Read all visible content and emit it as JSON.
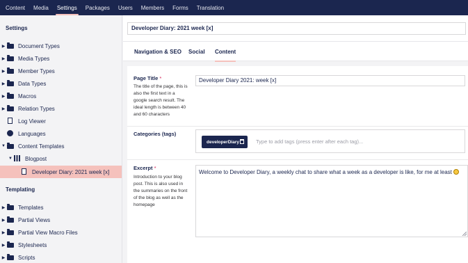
{
  "topnav": {
    "items": [
      {
        "label": "Content"
      },
      {
        "label": "Media"
      },
      {
        "label": "Settings",
        "active": true
      },
      {
        "label": "Packages"
      },
      {
        "label": "Users"
      },
      {
        "label": "Members"
      },
      {
        "label": "Forms"
      },
      {
        "label": "Translation"
      }
    ],
    "accent_color": "#f5c1bc",
    "background_color": "#1b264f"
  },
  "sidebar": {
    "settings_heading": "Settings",
    "items": [
      {
        "label": "Document Types",
        "icon": "folder-icon",
        "has_caret": true
      },
      {
        "label": "Media Types",
        "icon": "folder-icon",
        "has_caret": true
      },
      {
        "label": "Member Types",
        "icon": "folder-icon",
        "has_caret": true
      },
      {
        "label": "Data Types",
        "icon": "folder-icon",
        "has_caret": true
      },
      {
        "label": "Macros",
        "icon": "folder-icon",
        "has_caret": true
      },
      {
        "label": "Relation Types",
        "icon": "folder-icon",
        "has_caret": true
      },
      {
        "label": "Log Viewer",
        "icon": "document-icon",
        "has_caret": false
      },
      {
        "label": "Languages",
        "icon": "globe-icon",
        "has_caret": false
      },
      {
        "label": "Content Templates",
        "icon": "folder-icon",
        "has_caret": true,
        "expanded": true
      },
      {
        "label": "Blogpost",
        "icon": "grid-icon",
        "has_caret": true,
        "expanded": true
      },
      {
        "label": "Developer Diary: 2021 week [x]",
        "icon": "document-icon",
        "has_caret": false,
        "selected": true
      }
    ],
    "templating_heading": "Templating",
    "templating_items": [
      {
        "label": "Templates",
        "icon": "folder-icon",
        "has_caret": true
      },
      {
        "label": "Partial Views",
        "icon": "folder-icon",
        "has_caret": true
      },
      {
        "label": "Partial View Macro Files",
        "icon": "folder-icon",
        "has_caret": true
      },
      {
        "label": "Stylesheets",
        "icon": "folder-icon",
        "has_caret": true
      },
      {
        "label": "Scripts",
        "icon": "folder-icon",
        "has_caret": true
      }
    ],
    "selected_color": "#f5c1bc"
  },
  "editor": {
    "name_value": "Developer Diary: 2021 week [x]",
    "tabs": [
      {
        "label": "Navigation & SEO"
      },
      {
        "label": "Social"
      },
      {
        "label": "Content",
        "active": true
      }
    ],
    "properties": {
      "page_title": {
        "label": "Page Title",
        "required_mark": "*",
        "description": "The title of the page, this is also the first text in a google search result. The ideal length is between 40 and 60 characters",
        "value": "Developer Diary 2021: week [x]"
      },
      "categories": {
        "label": "Categories (tags)",
        "tags": [
          "developerDiary"
        ],
        "placeholder": "Type to add tags (press enter after each tag)..."
      },
      "excerpt": {
        "label": "Excerpt",
        "required_mark": "*",
        "description": "Introduction to your blog post. This is also used in the summaries on the front of the blog as well as the homepage",
        "value": "Welcome to Developer Diary, a weekly chat to share what a week as a developer is like, for me at least",
        "emoji": "smiley-icon"
      }
    },
    "required_color": "#d42054"
  }
}
